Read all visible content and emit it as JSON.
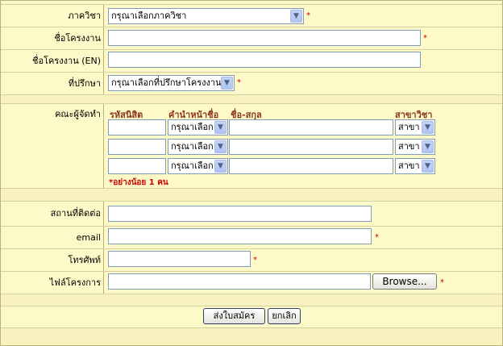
{
  "form": {
    "department": {
      "label": "ภาควิชา",
      "select": "กรุณาเลือกภาควิชา",
      "required": "*"
    },
    "project_name": {
      "label": "ชื่อโครงงาน",
      "value": "",
      "required": "*"
    },
    "project_name_en": {
      "label": "ชื่อโครงงาน (EN)",
      "value": ""
    },
    "advisor": {
      "label": "ที่ปรึกษา",
      "select": "กรุณาเลือกที่ปรึกษาโครงงาน",
      "required": "*"
    },
    "members": {
      "label": "คณะผู้จัดทำ",
      "headers": {
        "student_id": "รหัสนิสิต",
        "prefix": "คำนำหน้าชื่อ",
        "fullname": "ชื่อ-สกุล",
        "major": "สาขาวิชา"
      },
      "rows": [
        {
          "student_id": "",
          "prefix": "กรุณาเลือก",
          "fullname": "",
          "major": "สาขา"
        },
        {
          "student_id": "",
          "prefix": "กรุณาเลือก",
          "fullname": "",
          "major": "สาขา"
        },
        {
          "student_id": "",
          "prefix": "กรุณาเลือก",
          "fullname": "",
          "major": "สาขา"
        }
      ],
      "note": "*อย่างน้อย 1 คน"
    },
    "contact": {
      "label": "สถานที่ติดต่อ",
      "value": ""
    },
    "email": {
      "label": "email",
      "value": "",
      "required": "*"
    },
    "phone": {
      "label": "โทรศัพท์",
      "value": "",
      "required": "*"
    },
    "project_file": {
      "label": "ไฟล์โครงการ",
      "browse": "Browse...",
      "required": "*"
    }
  },
  "actions": {
    "submit": "ส่งใบสมัคร",
    "cancel": "ยกเลิก"
  },
  "colors": {
    "background": "#fdf9c8",
    "border": "#b9b37b",
    "required": "#cc0000",
    "header": "#8b3a1c"
  }
}
